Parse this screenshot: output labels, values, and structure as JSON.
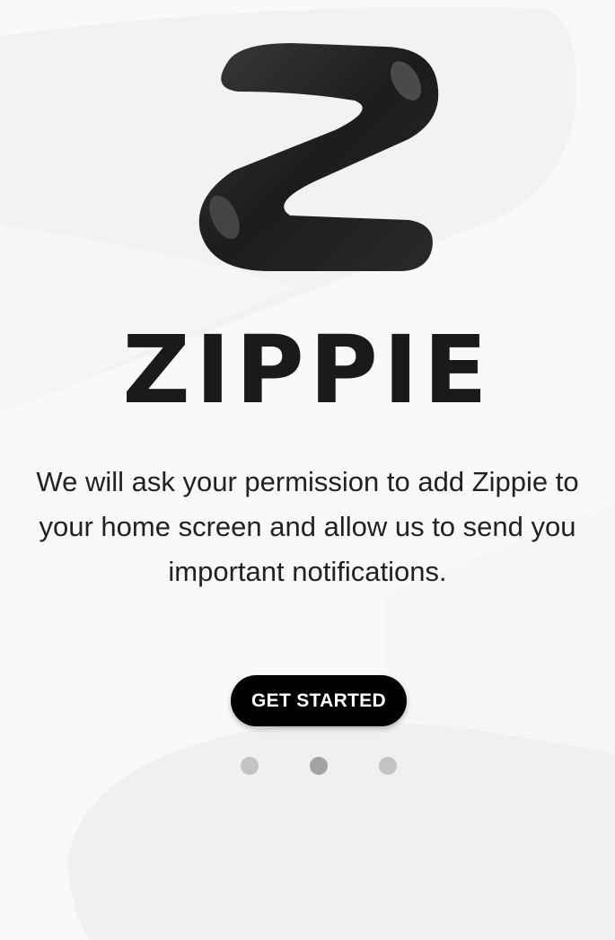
{
  "brand": {
    "logo_icon": "zippie-z-logo-icon",
    "title": "ZIPPIE"
  },
  "onboarding": {
    "description": "We will ask your permission to add Zippie to your home screen and allow us to send you important notifications.",
    "cta_label": "GET STARTED",
    "pages_total": 3,
    "current_page": 2
  },
  "colors": {
    "background": "#f9f9f9",
    "button": "#000000",
    "button_text": "#ffffff",
    "title": "#1a1a1a",
    "dot_inactive": "#c4c4c4",
    "dot_active": "#a3a3a3"
  }
}
